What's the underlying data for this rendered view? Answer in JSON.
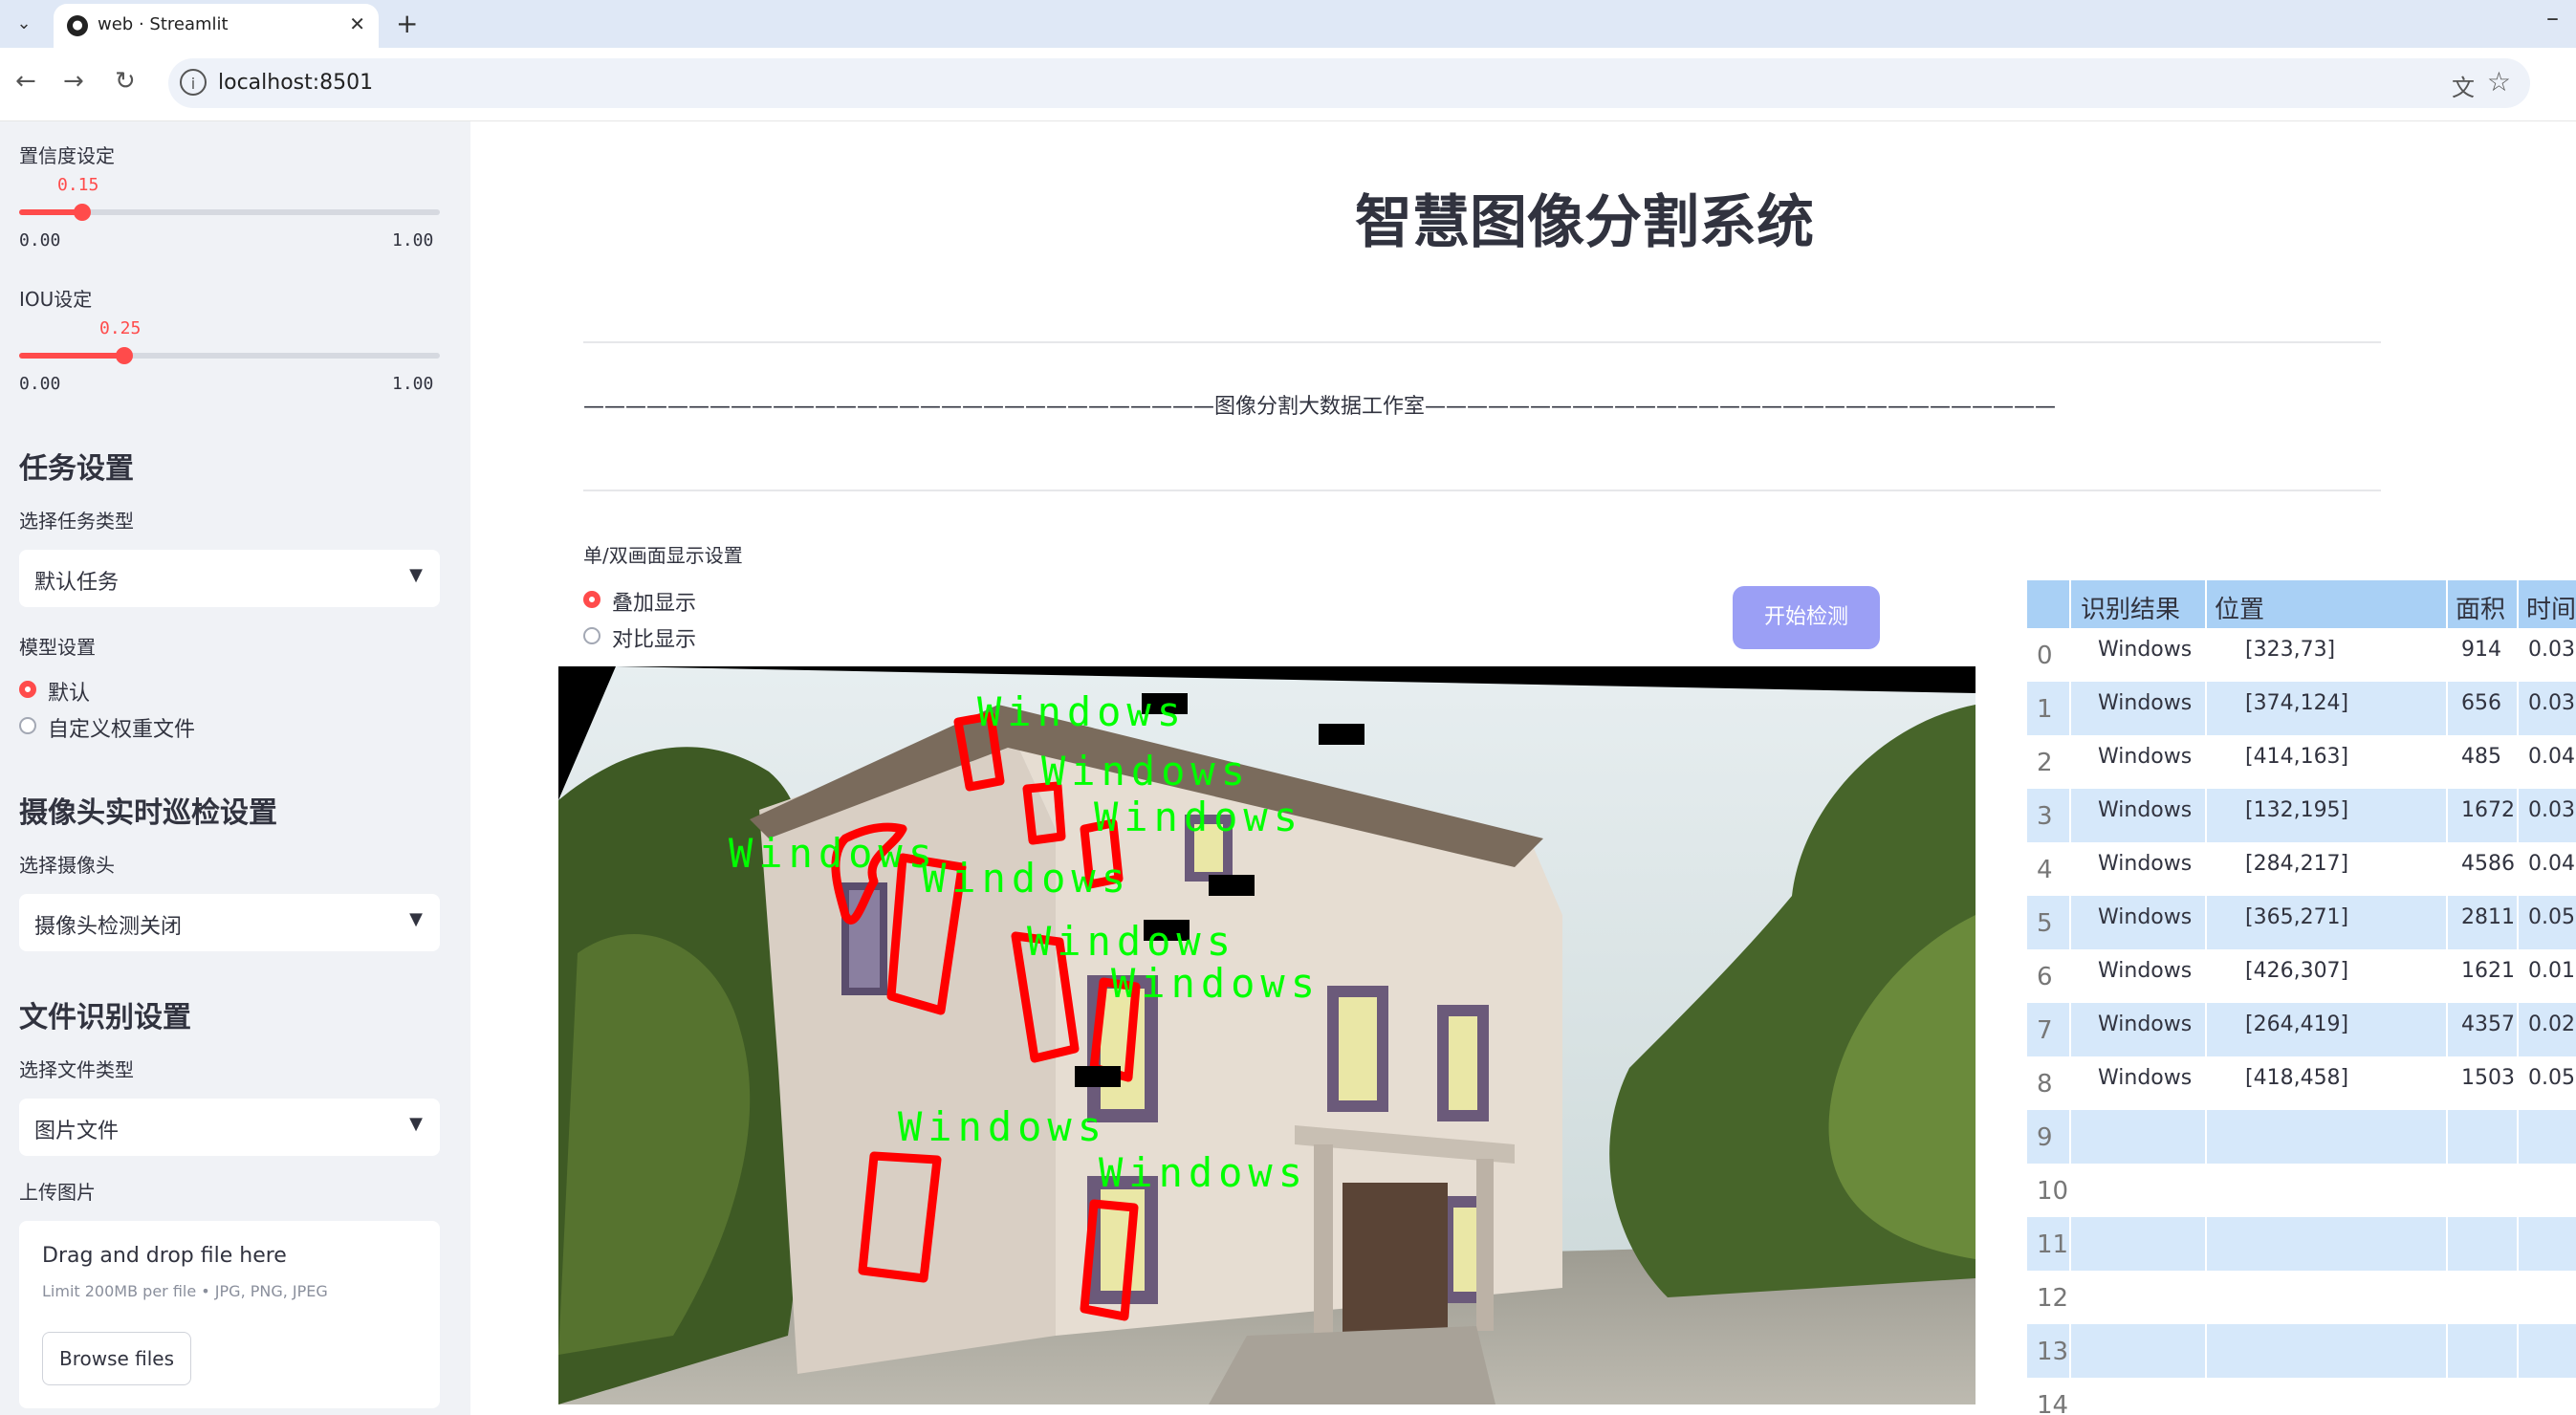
{
  "browser": {
    "tab_title": "web · Streamlit",
    "url": "localhost:8501"
  },
  "sidebar": {
    "confidence": {
      "label": "置信度设定",
      "value_text": "0.15",
      "value": 0.15,
      "min": "0.00",
      "max": "1.00"
    },
    "iou": {
      "label": "IOU设定",
      "value_text": "0.25",
      "value": 0.25,
      "min": "0.00",
      "max": "1.00"
    },
    "task_heading": "任务设置",
    "task_type_label": "选择任务类型",
    "task_type_value": "默认任务",
    "model_label": "模型设置",
    "model_options": [
      "默认",
      "自定义权重文件"
    ],
    "camera_heading": "摄像头实时巡检设置",
    "camera_label": "选择摄像头",
    "camera_value": "摄像头检测关闭",
    "file_heading": "文件识别设置",
    "file_type_label": "选择文件类型",
    "file_type_value": "图片文件",
    "upload_label": "上传图片",
    "uploader": {
      "title": "Drag and drop file here",
      "limit": "Limit 200MB per file • JPG, PNG, JPEG",
      "browse": "Browse files"
    }
  },
  "main": {
    "title": "智慧图像分割系统",
    "subtitle": "——————————————————————————————图像分割大数据工作室——————————————————————————————",
    "display_mode_label": "单/双画面显示设置",
    "display_options": [
      "叠加显示",
      "对比显示"
    ],
    "detect_button": "开始检测",
    "detection_label": "Windows"
  },
  "table": {
    "columns": [
      "识别结果",
      "位置",
      "面积",
      "时间"
    ],
    "rows": [
      {
        "idx": "0",
        "cls": "Windows",
        "pos": "[323,73]",
        "area": "914",
        "time": "0.03"
      },
      {
        "idx": "1",
        "cls": "Windows",
        "pos": "[374,124]",
        "area": "656",
        "time": "0.03"
      },
      {
        "idx": "2",
        "cls": "Windows",
        "pos": "[414,163]",
        "area": "485",
        "time": "0.04"
      },
      {
        "idx": "3",
        "cls": "Windows",
        "pos": "[132,195]",
        "area": "1672",
        "time": "0.03"
      },
      {
        "idx": "4",
        "cls": "Windows",
        "pos": "[284,217]",
        "area": "4586",
        "time": "0.04"
      },
      {
        "idx": "5",
        "cls": "Windows",
        "pos": "[365,271]",
        "area": "2811",
        "time": "0.05"
      },
      {
        "idx": "6",
        "cls": "Windows",
        "pos": "[426,307]",
        "area": "1621",
        "time": "0.01"
      },
      {
        "idx": "7",
        "cls": "Windows",
        "pos": "[264,419]",
        "area": "4357",
        "time": "0.02"
      },
      {
        "idx": "8",
        "cls": "Windows",
        "pos": "[418,458]",
        "area": "1503",
        "time": "0.05"
      },
      {
        "idx": "9",
        "cls": "",
        "pos": "",
        "area": "",
        "time": ""
      },
      {
        "idx": "10",
        "cls": "",
        "pos": "",
        "area": "",
        "time": ""
      },
      {
        "idx": "11",
        "cls": "",
        "pos": "",
        "area": "",
        "time": ""
      },
      {
        "idx": "12",
        "cls": "",
        "pos": "",
        "area": "",
        "time": ""
      },
      {
        "idx": "13",
        "cls": "",
        "pos": "",
        "area": "",
        "time": ""
      },
      {
        "idx": "14",
        "cls": "",
        "pos": "",
        "area": "",
        "time": ""
      }
    ]
  },
  "colors": {
    "accent": "#ff4b4b",
    "button": "#9b9ff5",
    "table_header": "#a9d0f5",
    "table_stripe": "#d6e8fa",
    "mask": "#ff0000",
    "label": "#00ff00"
  }
}
